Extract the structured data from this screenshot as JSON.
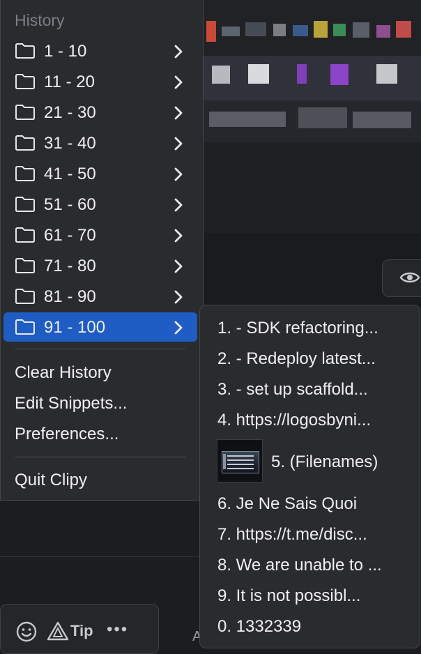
{
  "menu": {
    "header": "History",
    "folders": [
      {
        "label": "1 - 10"
      },
      {
        "label": "11 - 20"
      },
      {
        "label": "21 - 30"
      },
      {
        "label": "31 - 40"
      },
      {
        "label": "41 - 50"
      },
      {
        "label": "51 - 60"
      },
      {
        "label": "61 - 70"
      },
      {
        "label": "71 - 80"
      },
      {
        "label": "81 - 90"
      },
      {
        "label": "91 - 100",
        "selected": true
      }
    ],
    "actions": {
      "clear_history": "Clear History",
      "edit_snippets": "Edit Snippets...",
      "preferences": "Preferences...",
      "quit": "Quit Clipy"
    }
  },
  "submenu": {
    "items": [
      "1. - SDK refactoring...",
      "2. - Redeploy latest...",
      "3. - set up scaffold...",
      "4. https://logosbyni...",
      "5. (Filenames)",
      "6. Je Ne Sais Quoi",
      "7. https://t.me/disc...",
      "8. We are unable to ...",
      "9. It is not possibl...",
      "0. 1332339"
    ],
    "highlighted_item": "5. (Filenames)"
  },
  "background": {
    "tip_label": "Tip",
    "peek_text": "A",
    "icons": [
      "eye-icon",
      "smiley-icon",
      "tip-triangle-icon",
      "more-dots-icon"
    ]
  },
  "colors": {
    "menu_bg": "#2a2b2f",
    "selection": "#1f5cc4",
    "highlight_box": "#ff1a1a",
    "header_text": "#7d7e84"
  }
}
